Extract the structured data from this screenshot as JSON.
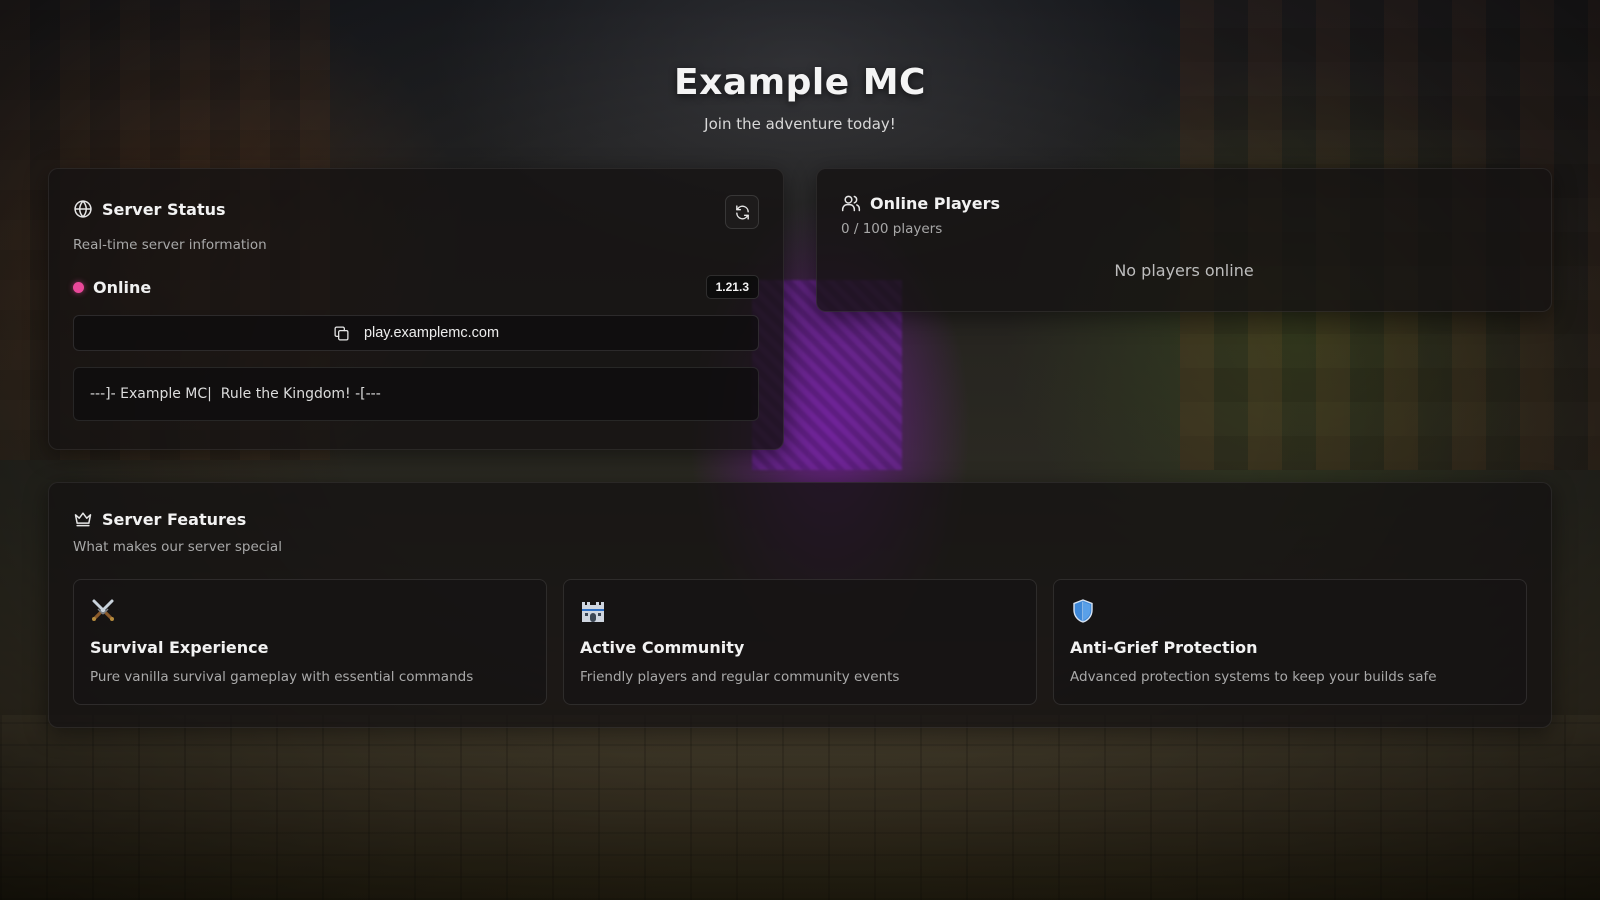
{
  "hero": {
    "title": "Example MC",
    "subtitle": "Join the adventure today!"
  },
  "status_card": {
    "title": "Server Status",
    "subtitle": "Real-time server information",
    "icon": "globe-icon",
    "refresh_icon": "refresh-icon",
    "status_text": "Online",
    "status_color": "#e9489a",
    "version": "1.21.3",
    "address": "play.examplemc.com",
    "copy_icon": "copy-icon",
    "motd": "---]- Example MC|  Rule the Kingdom! -[---"
  },
  "players_card": {
    "title": "Online Players",
    "icon": "users-icon",
    "count_text": "0 / 100 players",
    "empty_text": "No players online"
  },
  "features_card": {
    "title": "Server Features",
    "icon": "crown-icon",
    "subtitle": "What makes our server special",
    "features": [
      {
        "icon": "crossed-swords-icon",
        "title": "Survival Experience",
        "description": "Pure vanilla survival gameplay with essential commands"
      },
      {
        "icon": "castle-icon",
        "title": "Active Community",
        "description": "Friendly players and regular community events"
      },
      {
        "icon": "shield-icon",
        "title": "Anti-Grief Protection",
        "description": "Advanced protection systems to keep your builds safe"
      }
    ]
  }
}
